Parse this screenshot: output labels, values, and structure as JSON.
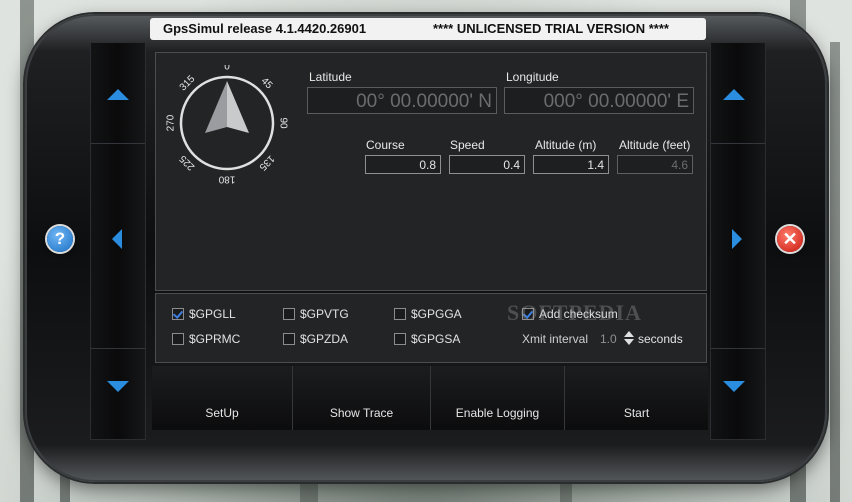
{
  "window": {
    "title": "GpsSimul release 4.1.4420.26901",
    "notice": "**** UNLICENSED TRIAL VERSION ****"
  },
  "compass": {
    "labels": [
      "0",
      "45",
      "90",
      "135",
      "180",
      "225",
      "270",
      "315"
    ],
    "heading_deg": 0
  },
  "position": {
    "latitude_label": "Latitude",
    "latitude_value": "00° 00.00000' N",
    "longitude_label": "Longitude",
    "longitude_value": "000° 00.00000' E"
  },
  "motion": {
    "course_label": "Course",
    "course_value": "0.8",
    "speed_label": "Speed",
    "speed_value": "0.4",
    "altitude_m_label": "Altitude (m)",
    "altitude_m_value": "1.4",
    "altitude_ft_label": "Altitude (feet)",
    "altitude_ft_value": "4.6"
  },
  "sentences": {
    "items": [
      {
        "label": "$GPGLL",
        "checked": true
      },
      {
        "label": "$GPVTG",
        "checked": false
      },
      {
        "label": "$GPGGA",
        "checked": false
      },
      {
        "label": "$GPRMC",
        "checked": false
      },
      {
        "label": "$GPZDA",
        "checked": false
      },
      {
        "label": "$GPGSA",
        "checked": false
      }
    ],
    "checksum_label": "Add checksum",
    "checksum_checked": true,
    "xmit_label": "Xmit interval",
    "xmit_value": "1.0",
    "xmit_unit": "seconds"
  },
  "buttons": {
    "setup": "SetUp",
    "show_trace": "Show Trace",
    "enable_logging": "Enable Logging",
    "start": "Start"
  },
  "side": {
    "help_glyph": "?",
    "close_glyph": "✕"
  },
  "watermark": "SOFTPEDIA",
  "colors": {
    "accent": "#2a8de0",
    "close": "#c8170c",
    "help": "#1b6fc4"
  }
}
